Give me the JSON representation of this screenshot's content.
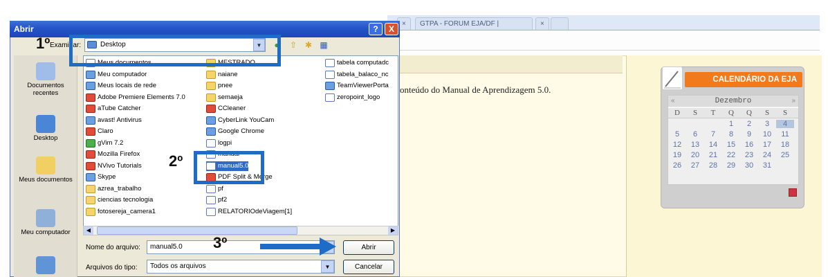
{
  "browser": {
    "tabs": [
      "×",
      "GTPA - FORUM EJA/DF |",
      "×"
    ],
    "content_text": "onteúdo do Manual de Aprendizagem 5.0."
  },
  "calendar": {
    "title": "CALENDÁRIO DA EJA",
    "prev": "«",
    "next": "»",
    "month": "Dezembro",
    "weekdays": [
      "D",
      "S",
      "T",
      "Q",
      "Q",
      "S",
      "S"
    ],
    "weeks": [
      [
        "",
        "",
        "",
        "",
        "1",
        "2",
        "3",
        "4"
      ],
      [
        "5",
        "6",
        "7",
        "8",
        "9",
        "10",
        "11"
      ],
      [
        "12",
        "13",
        "14",
        "15",
        "16",
        "17",
        "18"
      ],
      [
        "19",
        "20",
        "21",
        "22",
        "23",
        "24",
        "25"
      ],
      [
        "26",
        "27",
        "28",
        "29",
        "30",
        "31",
        ""
      ]
    ],
    "selected_day": "4"
  },
  "dialog": {
    "title": "Abrir",
    "help": "?",
    "close": "X",
    "lookin_label": "Examinar:",
    "lookin_value": "Desktop",
    "places": [
      {
        "label": "Documentos recentes"
      },
      {
        "label": "Desktop"
      },
      {
        "label": "Meus documentos"
      },
      {
        "label": "Meu computador"
      }
    ],
    "files_col1": [
      "Meus documentos",
      "Meu computador",
      "Meus locais de rede",
      "Adobe Premiere Elements 7.0",
      "aTube Catcher",
      "avast! Antivirus",
      "Claro",
      "gVim 7.2",
      "Mozilla Firefox",
      "NVivo Tutorials",
      "Skype",
      "azrea_trabalho",
      "ciencias tecnologia",
      "fotosereja_camera1"
    ],
    "files_col2": [
      "MESTRADO",
      "naiane",
      "pnee",
      "semaeja",
      "CCleaner",
      "CyberLink YouCam",
      "Google Chrome",
      "logpi",
      "manual",
      "manual5.0",
      "PDF Split & Merge",
      "pf",
      "pf2",
      "RELATORIOdeViagem[1]"
    ],
    "files_col3": [
      "tabela computadc",
      "tabela_balaco_nc",
      "TeamViewerPorta",
      "zeropoint_logo"
    ],
    "filename_label": "Nome do arquivo:",
    "filename_value": "manual5.0",
    "filetype_label": "Arquivos do tipo:",
    "filetype_value": "Todos os arquivos",
    "open_button": "Abrir",
    "cancel_button": "Cancelar"
  },
  "annotations": {
    "step1": "1º",
    "step2": "2º",
    "step3": "3º"
  },
  "colors": {
    "annotation_blue": "#1e6cc8",
    "title_bar": "#2454c8",
    "calendar_orange": "#f07a1c"
  }
}
